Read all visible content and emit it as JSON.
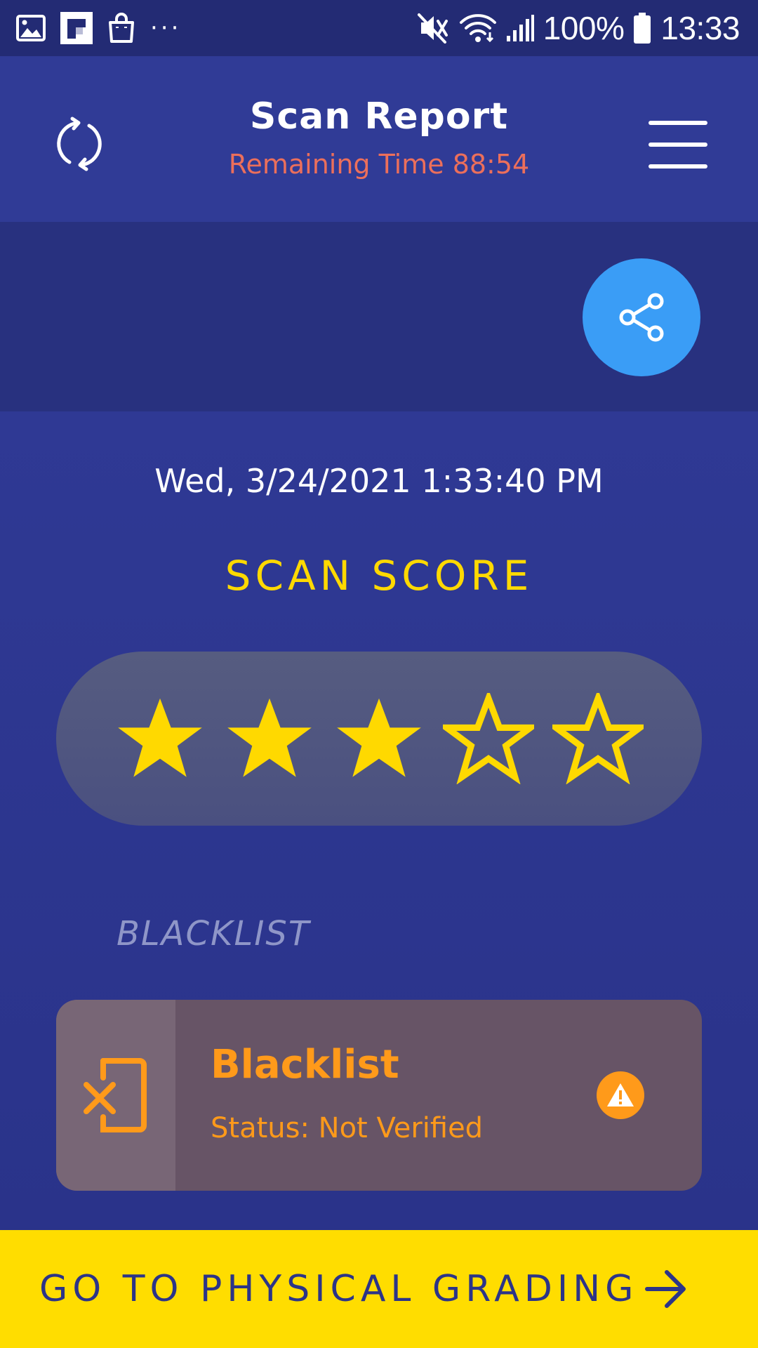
{
  "status_bar": {
    "battery": "100%",
    "time": "13:33",
    "left_icons": [
      "gallery-icon",
      "flipboard-icon",
      "shopping-bag-icon",
      "more-dots-icon"
    ],
    "right_icons": [
      "mute-icon",
      "wifi-icon",
      "signal-icon",
      "battery-icon"
    ]
  },
  "header": {
    "title": "Scan Report",
    "subtitle": "Remaining Time 88:54",
    "left_icon": "refresh-icon",
    "right_icon": "hamburger-menu-icon"
  },
  "actions": {
    "share_icon": "share-icon"
  },
  "report": {
    "datetime": "Wed, 3/24/2021 1:33:40 PM",
    "score_label": "SCAN SCORE",
    "rating": {
      "filled": 3,
      "total": 5
    }
  },
  "sections": [
    {
      "label": "BLACKLIST",
      "card": {
        "icon": "phone-x-icon",
        "title": "Blacklist",
        "status": "Status: Not Verified",
        "status_icon": "warning-icon"
      }
    }
  ],
  "footer": {
    "cta_label": "GO TO PHYSICAL GRADING",
    "cta_icon": "arrow-right-icon"
  },
  "colors": {
    "background": "#2c368f",
    "header": "#303b96",
    "accent_yellow": "#ffd900",
    "share_blue": "#3a9df6",
    "warning_orange": "#ff9a1a",
    "subtitle_red": "#ec6f5b"
  }
}
